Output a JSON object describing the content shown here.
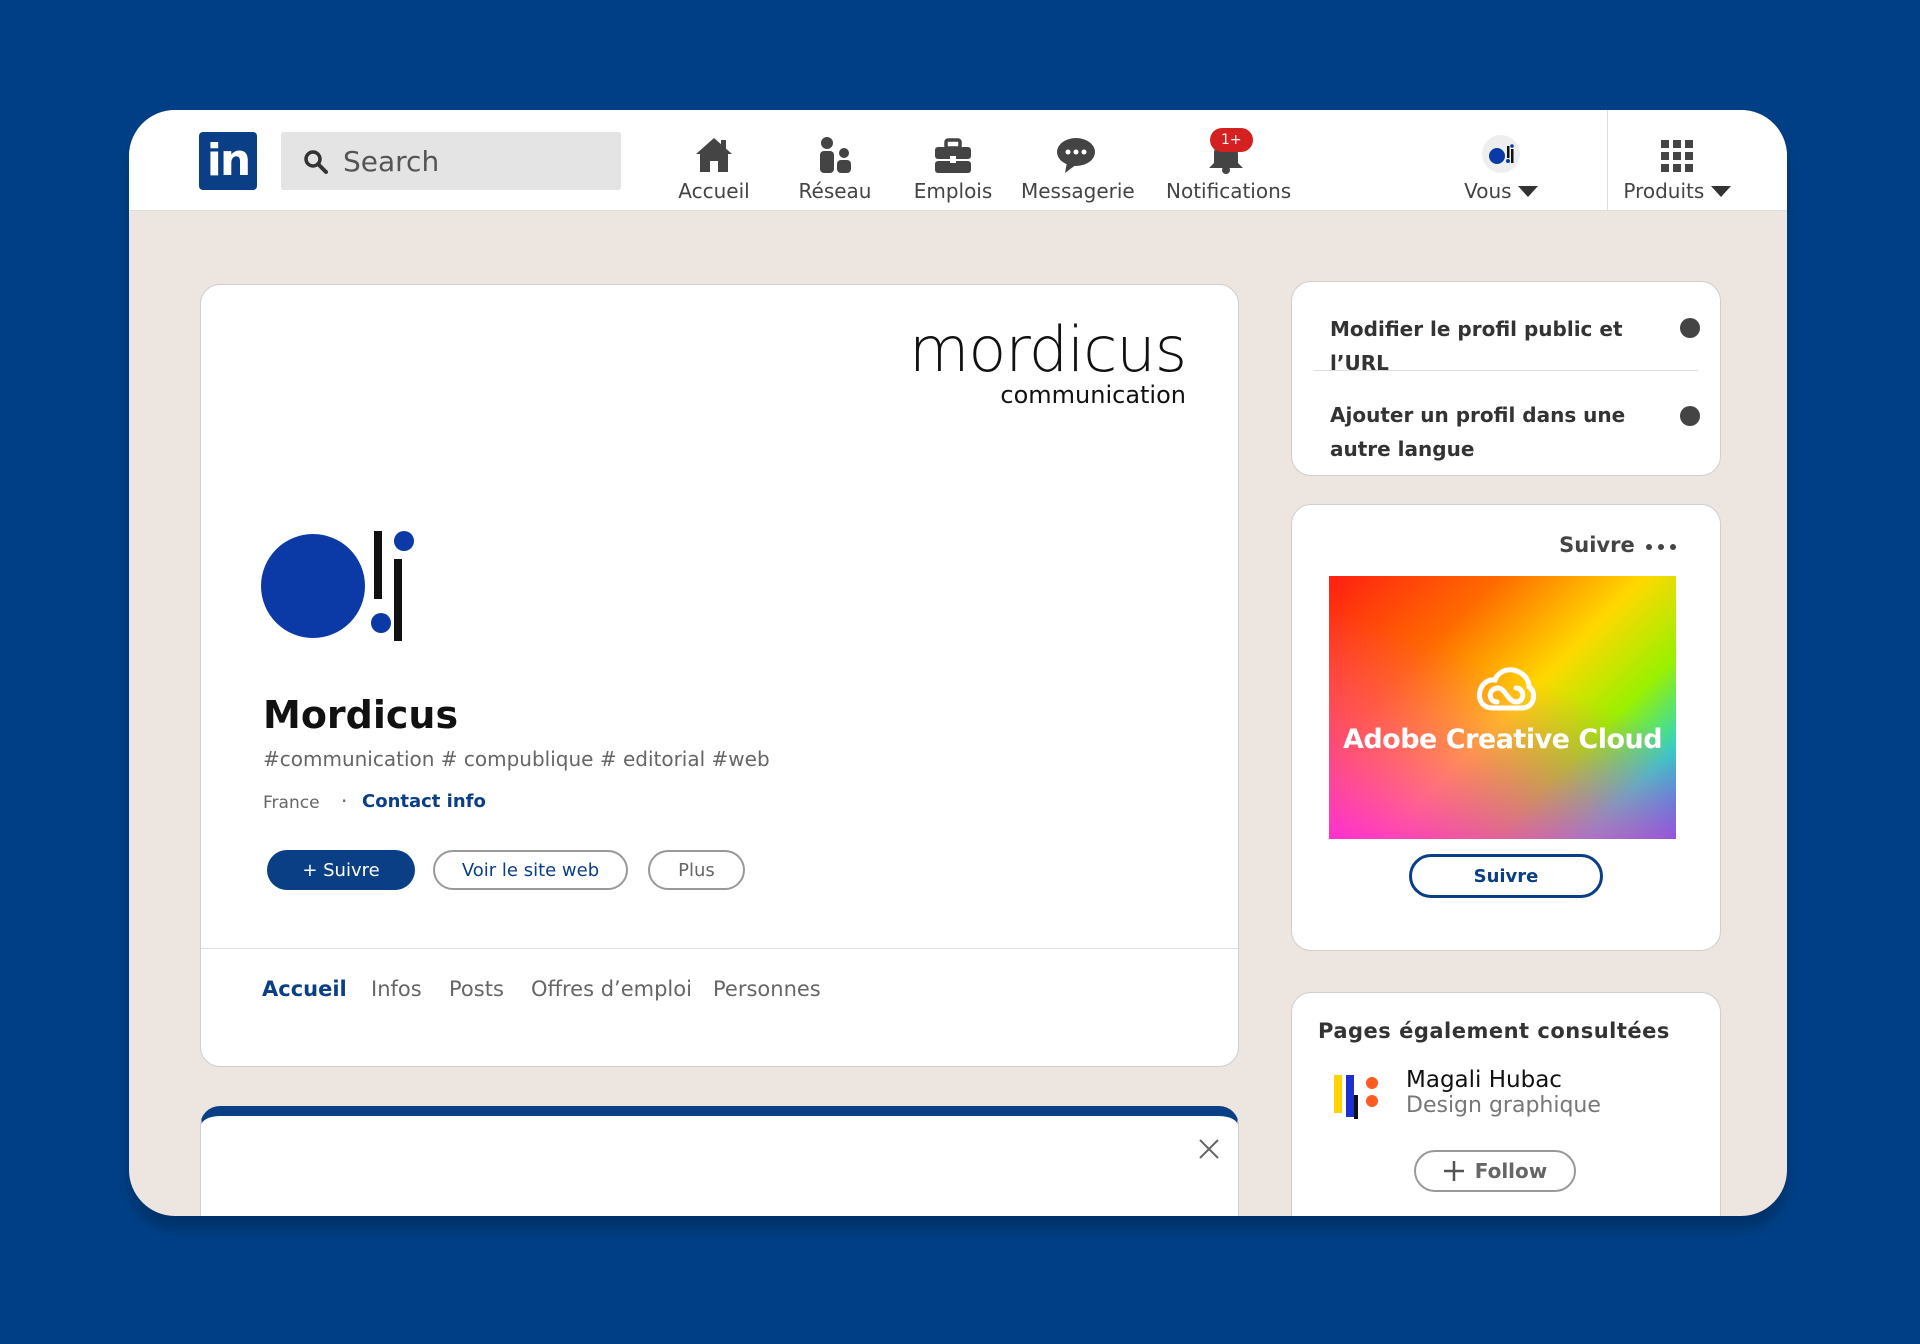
{
  "topbar": {
    "search_placeholder": "Search",
    "nav": [
      {
        "label": "Accueil",
        "icon": "home-icon"
      },
      {
        "label": "Réseau",
        "icon": "network-icon"
      },
      {
        "label": "Emplois",
        "icon": "briefcase-icon"
      },
      {
        "label": "Messagerie",
        "icon": "chat-icon"
      },
      {
        "label": "Notifications",
        "icon": "bell-icon",
        "badge": "1+"
      },
      {
        "label": "Vous",
        "icon": "avatar"
      },
      {
        "label": "Produits",
        "icon": "grid-icon"
      }
    ]
  },
  "profile": {
    "wordmark": "mordicus",
    "wordmark_sub": "communication",
    "name": "Mordicus",
    "tags": "#communication # compublique # editorial #web",
    "location": "France",
    "separator": "·",
    "contact": "Contact info",
    "buttons": {
      "follow": "+ Suivre",
      "website": "Voir le site web",
      "more": "Plus"
    },
    "tabs": [
      "Accueil",
      "Infos",
      "Posts",
      "Offres d’emploi",
      "Personnes"
    ],
    "active_tab": "Accueil"
  },
  "sidebar": {
    "settings": [
      "Modifier le profil public et l’URL",
      "Ajouter un profil dans une autre langue"
    ],
    "ad": {
      "header": "Suivre",
      "brand": "Adobe Creative Cloud",
      "button": "Suivre"
    },
    "also_viewed": {
      "title": "Pages également consultées",
      "name": "Magali Hubac",
      "subtitle": "Design graphique",
      "button": "Follow"
    }
  },
  "colors": {
    "background": "#003f85",
    "brand": "#0a3f86",
    "canvas": "#ede5e0",
    "badge": "#d42020"
  }
}
